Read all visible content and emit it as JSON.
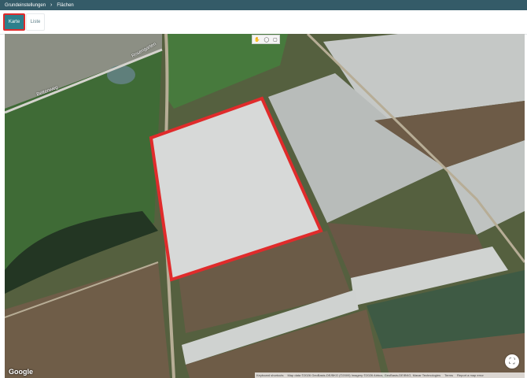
{
  "breadcrumb": {
    "root": "Grundeinstellungen",
    "separator": "›",
    "current": "Flächen"
  },
  "view_tabs": {
    "map_label": "Karte",
    "list_label": "Liste",
    "active": "map"
  },
  "map": {
    "road_labels": [
      "Rosengarten",
      "Bettenweg"
    ],
    "provider_logo": "Google",
    "attribution": {
      "keyboard_shortcuts": "Keyboard shortcuts",
      "map_data": "Map data ©2026 GeoBasis-DE/BKG (©2009) Imagery ©2026 Airbus, GeoBasis-DE/BKG, Maxar Technologies",
      "terms": "Terms",
      "report": "Report a map error"
    },
    "tools": [
      "hand-icon",
      "circle-icon",
      "square-icon"
    ],
    "fullscreen_icon": "fullscreen-icon",
    "selection_color": "#e02b2b"
  }
}
